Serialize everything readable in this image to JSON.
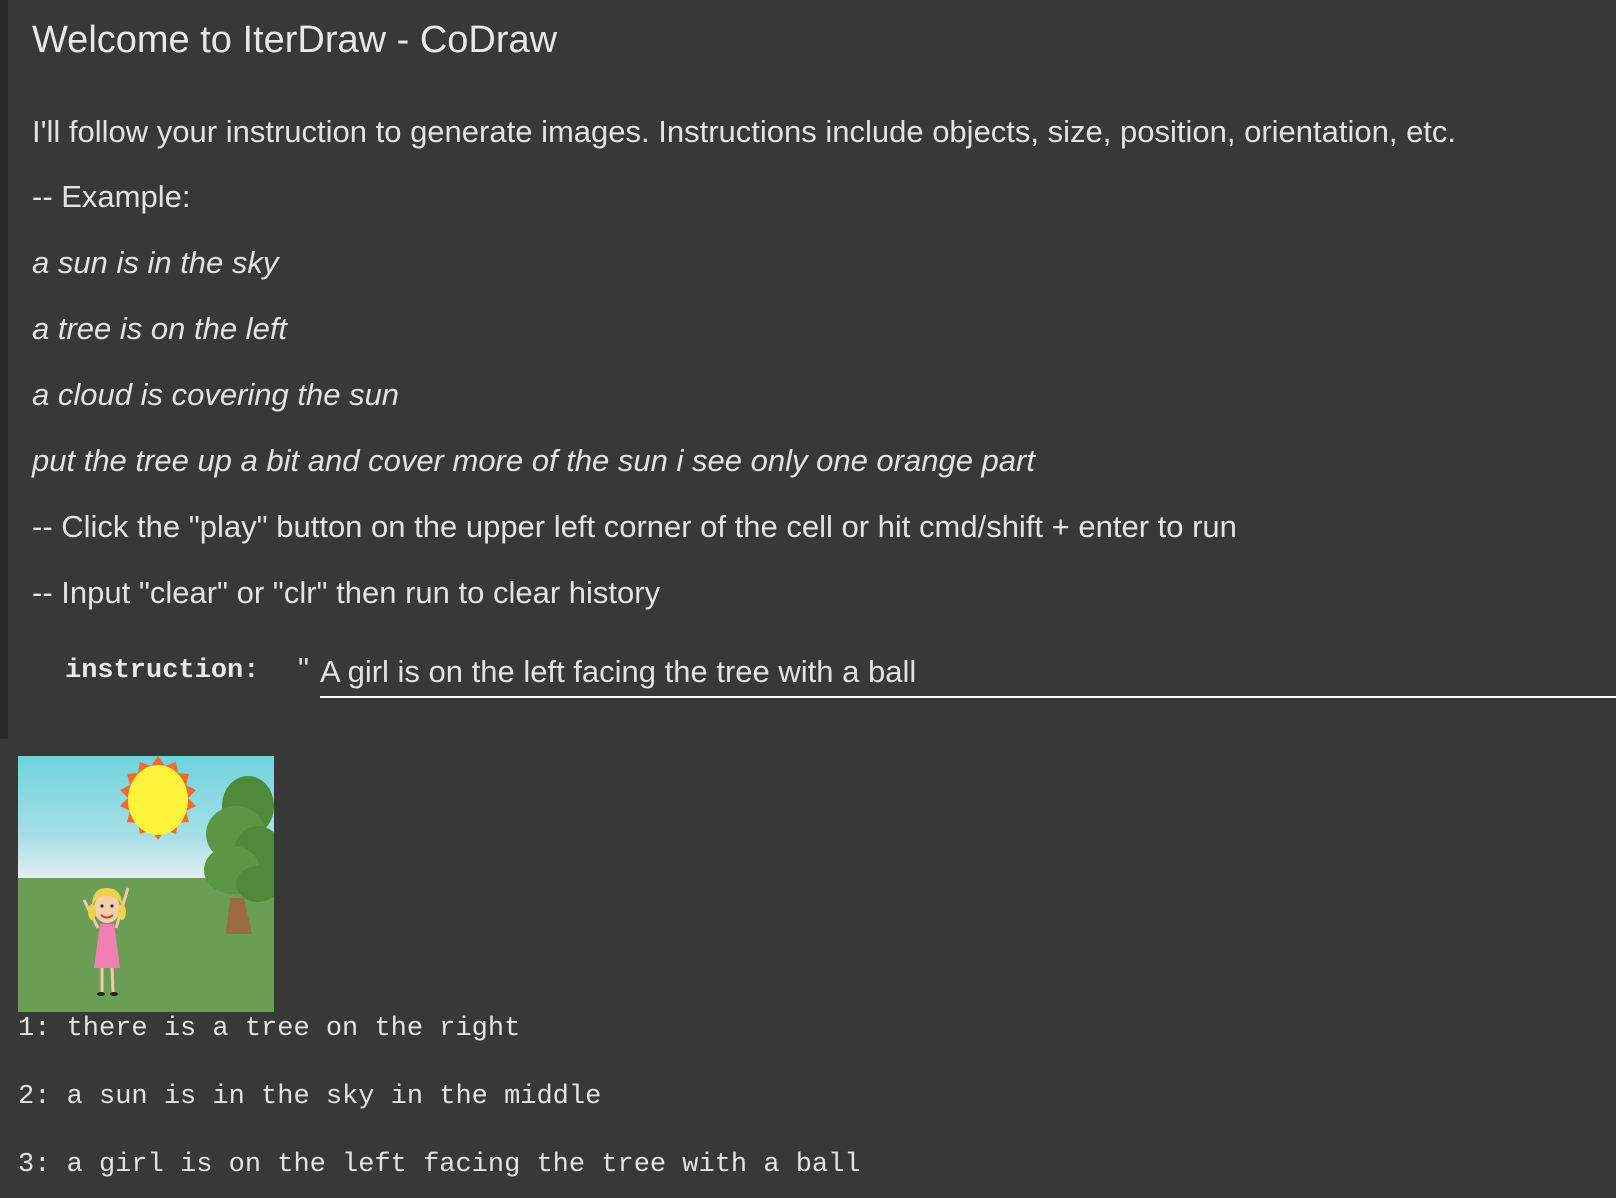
{
  "title": "Welcome to IterDraw - CoDraw",
  "intro": "I'll follow your instruction to generate images. Instructions include objects, size, position, orientation, etc.",
  "example_heading": "-- Example:",
  "examples": [
    "a sun is in the sky",
    "a tree is on the left",
    "a cloud is covering the sun",
    "put the tree up a bit and cover more of the sun i see only one orange part"
  ],
  "tips": [
    "-- Click the \"play\" button on the upper left corner of the cell or hit cmd/shift + enter to run",
    "-- Input \"clear\" or \"clr\" then run to clear history"
  ],
  "form": {
    "label": "instruction:",
    "quote": "\"",
    "value": "A girl is on the left facing the tree with a ball"
  },
  "history": [
    "1: there is a tree on the right",
    "2: a sun is in the sky in the middle",
    "3: a girl is on the left facing the tree with a ball"
  ],
  "colors": {
    "background": "#383838",
    "text": "#e3e3e3",
    "sky": "#7fd4dc",
    "grass": "#6a9e55",
    "sun": "#fff23a",
    "sun_rays": "#ef6a2c"
  }
}
